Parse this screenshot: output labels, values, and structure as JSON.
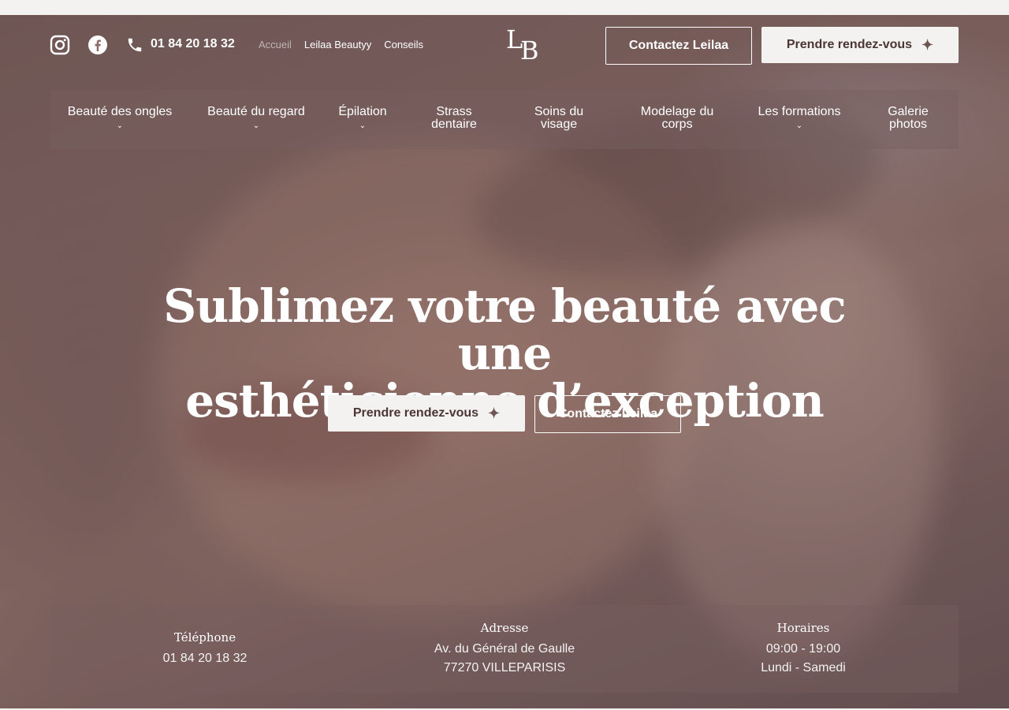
{
  "header": {
    "phone": "01 84 20 18 32",
    "links": [
      "Accueil",
      "Leilaa Beautyy",
      "Conseils"
    ],
    "logo_letters": [
      "L",
      "B"
    ],
    "contact_label": "Contactez Leilaa",
    "rdv_label": "Prendre rendez-vous",
    "icons": [
      "instagram-icon",
      "facebook-icon",
      "phone-icon",
      "sparkle-icon"
    ]
  },
  "nav": {
    "items": [
      {
        "line1": "Beauté des ongles",
        "line2": "",
        "chevron": "⌄"
      },
      {
        "line1": "Beauté du regard",
        "line2": "",
        "chevron": "⌄"
      },
      {
        "line1": "Épilation",
        "line2": "",
        "chevron": "⌄"
      },
      {
        "line1": "Strass",
        "line2": "dentaire",
        "chevron": ""
      },
      {
        "line1": "Soins du",
        "line2": "visage",
        "chevron": ""
      },
      {
        "line1": "Modelage du",
        "line2": "corps",
        "chevron": ""
      },
      {
        "line1": "Les formations",
        "line2": "",
        "chevron": "⌄"
      },
      {
        "line1": "Galerie",
        "line2": "photos",
        "chevron": ""
      }
    ]
  },
  "hero": {
    "title_line1": "Sublimez votre beauté avec une",
    "title_line2": "esthéticienne d’exception",
    "rdv_label": "Prendre rendez-vous",
    "contact_label": "Contactez Leilaa"
  },
  "info": {
    "telephone_title": "Téléphone",
    "telephone_value": "01 84 20 18 32",
    "adresse_title": "Adresse",
    "adresse_line1": "Av. du Général de Gaulle",
    "adresse_line2": "77270 VILLEPARISIS",
    "horaires_title": "Horaires",
    "horaires_line1": "09:00 - 19:00",
    "horaires_line2": "Lundi - Samedi"
  },
  "colors": {
    "accent_light": "#f4f2f0",
    "accent_dark": "#4b3535"
  }
}
